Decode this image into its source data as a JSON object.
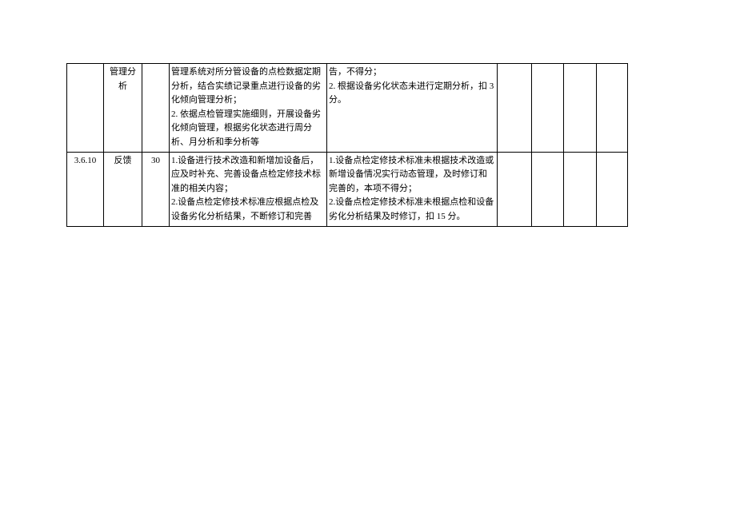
{
  "rows": [
    {
      "id": "",
      "name": "管理分析",
      "score": "",
      "desc": "管理系统对所分管设备的点检数据定期分析，结合实绩记录重点进行设备的劣化倾向管理分析；\n2. 依据点检管理实施细则，开展设备劣化倾向管理，根据劣化状态进行周分析、月分析和季分析等",
      "rule": "告，不得分；\n2. 根据设备劣化状态未进行定期分析，扣 3 分。"
    },
    {
      "id": "3.6.10",
      "name": "反馈",
      "score": "30",
      "desc": "1.设备进行技术改造和新增加设备后，应及时补充、完善设备点检定修技术标准的相关内容；\n2.设备点检定修技术标准应根据点检及设备劣化分析结果，不断修订和完善",
      "rule": "1.设备点检定修技术标准未根据技术改造或新增设备情况实行动态管理，及时修订和完善的，本项不得分；\n2.设备点检定修技术标准未根据点检和设备劣化分析结果及时修订，扣 15 分。"
    }
  ]
}
